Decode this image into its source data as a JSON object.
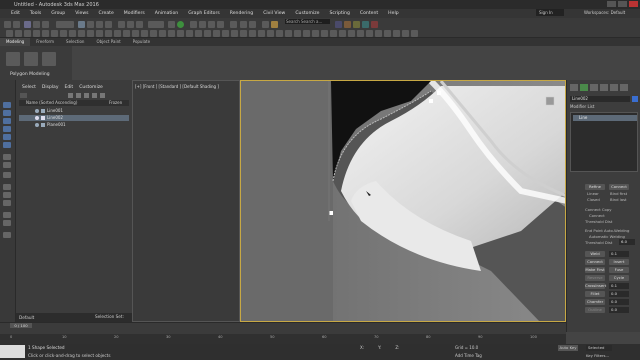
{
  "window": {
    "title": "Untitled - Autodesk 3ds Max 2016"
  },
  "menubar": {
    "items": [
      "Edit",
      "Tools",
      "Group",
      "Views",
      "Create",
      "Modifiers",
      "Animation",
      "Graph Editors",
      "Rendering",
      "Civil View",
      "Customize",
      "Scripting",
      "Content",
      "Help"
    ],
    "search_placeholder": "Search Search a...",
    "signin": "Sign In",
    "workspace_label": "Workspaces:",
    "workspace_value": "Default"
  },
  "ribbon": {
    "tabs": [
      "Modeling",
      "Freeform",
      "Selection",
      "Object Paint",
      "Populate"
    ],
    "panel_label": "Polygon Modeling"
  },
  "scene_explorer": {
    "tabs": [
      "Select",
      "Display",
      "Edit",
      "Customize"
    ],
    "header_name": "Name (Sorted Ascending)",
    "header_frozen": "Frozen",
    "rows": [
      {
        "name": "Line001",
        "selected": false
      },
      {
        "name": "Line002",
        "selected": true
      },
      {
        "name": "Plane001",
        "selected": false
      }
    ],
    "layer": "Default",
    "selection_set": "Selection Set:"
  },
  "left_viewport": {
    "label": "[+] [Front ] [Standard ] [Default Shading ]"
  },
  "command_panel": {
    "object_name": "Line002",
    "swatch_color": "#3a6ed0",
    "modifier_list": "Modifier List",
    "stack_item": "Line",
    "buttons": [
      {
        "label": "Refine"
      },
      {
        "label": "Connect"
      },
      {
        "label": "Linear"
      },
      {
        "label": "Bind first"
      },
      {
        "label": "Closed"
      },
      {
        "label": "Bind last"
      }
    ],
    "connect_copy": "Connect Copy",
    "connect": "Connect",
    "threshold_distance": "Threshold Dist",
    "end_point_welding": "End Point Auto-Welding",
    "automatic_welding": "Automatic Welding",
    "threshold_dist_value": "6.0",
    "ops": [
      {
        "label": "Weld",
        "value": "0.1"
      },
      {
        "label": "Connect",
        "value": "Insert"
      },
      {
        "label": "Make First",
        "value": "Fuse"
      },
      {
        "label": "Reverse",
        "value": "Cycle"
      },
      {
        "label": "CrossInsert",
        "value": "0.1"
      },
      {
        "label": "Fillet",
        "value": "0.0"
      },
      {
        "label": "Chamfer",
        "value": "0.0"
      },
      {
        "label": "Outline",
        "value": "0.0"
      }
    ]
  },
  "timeline": {
    "frame": "0 / 100",
    "ticks": [
      "0",
      "10",
      "20",
      "30",
      "40",
      "50",
      "60",
      "70",
      "80",
      "90",
      "100"
    ]
  },
  "status": {
    "line1": "1 Shape Selected",
    "line2": "Click or click-and-drag to select objects",
    "grid": "Grid = 10.0",
    "add_time_tag": "Add Time Tag",
    "auto_key": "Auto Key",
    "selected": "Selected",
    "key_filters": "Key Filters...",
    "x_label": "X:",
    "y_label": "Y:",
    "z_label": "Z:"
  }
}
